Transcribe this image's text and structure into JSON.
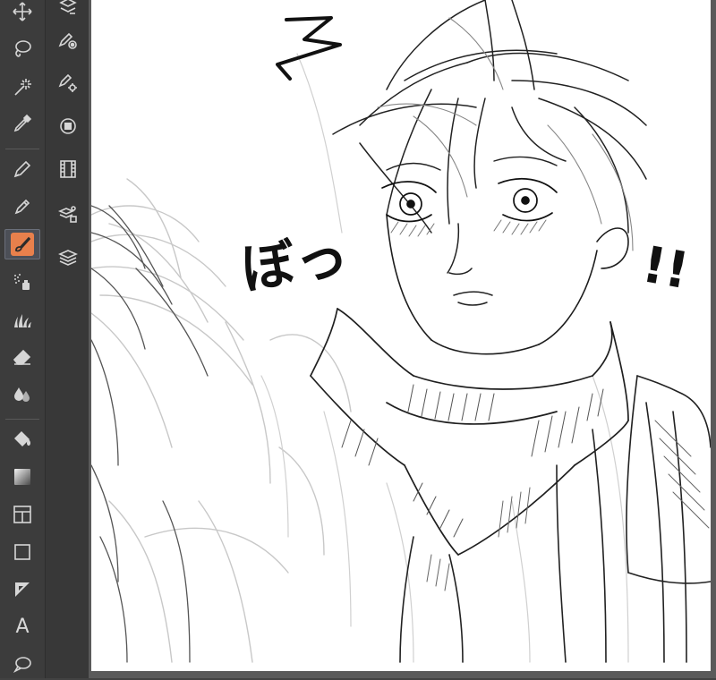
{
  "colors": {
    "accent": "#e8804c",
    "icon": "#d6d6d6",
    "panel": "#3c3c3c",
    "canvas": "#ffffff"
  },
  "tools": [
    {
      "icon": "move-icon"
    },
    {
      "icon": "lasso-icon"
    },
    {
      "icon": "magic-wand-icon"
    },
    {
      "icon": "eyedropper-icon"
    },
    {
      "icon": "pen-icon"
    },
    {
      "icon": "pencil-icon"
    },
    {
      "icon": "brush-icon",
      "active": true
    },
    {
      "icon": "airbrush-icon"
    },
    {
      "icon": "decoration-grass-icon"
    },
    {
      "icon": "eraser-icon"
    },
    {
      "icon": "blend-icon"
    },
    {
      "icon": "fill-bucket-icon"
    },
    {
      "icon": "gradient-icon"
    },
    {
      "icon": "frame-border-icon"
    },
    {
      "icon": "rectangle-shape-icon"
    },
    {
      "icon": "ruler-icon"
    },
    {
      "icon": "text-icon",
      "glyph": "A"
    },
    {
      "icon": "balloon-icon"
    }
  ],
  "subtools": [
    {
      "icon": "layer-select-icon"
    },
    {
      "icon": "correct-line-icon"
    },
    {
      "icon": "line-settings-icon"
    },
    {
      "icon": "object-icon"
    },
    {
      "icon": "animation-film-icon"
    },
    {
      "icon": "material-icon"
    },
    {
      "icon": "layers-icon"
    }
  ],
  "canvas": {
    "sfx_bo": "ぼっ",
    "sfx_exclaim": "!!"
  }
}
